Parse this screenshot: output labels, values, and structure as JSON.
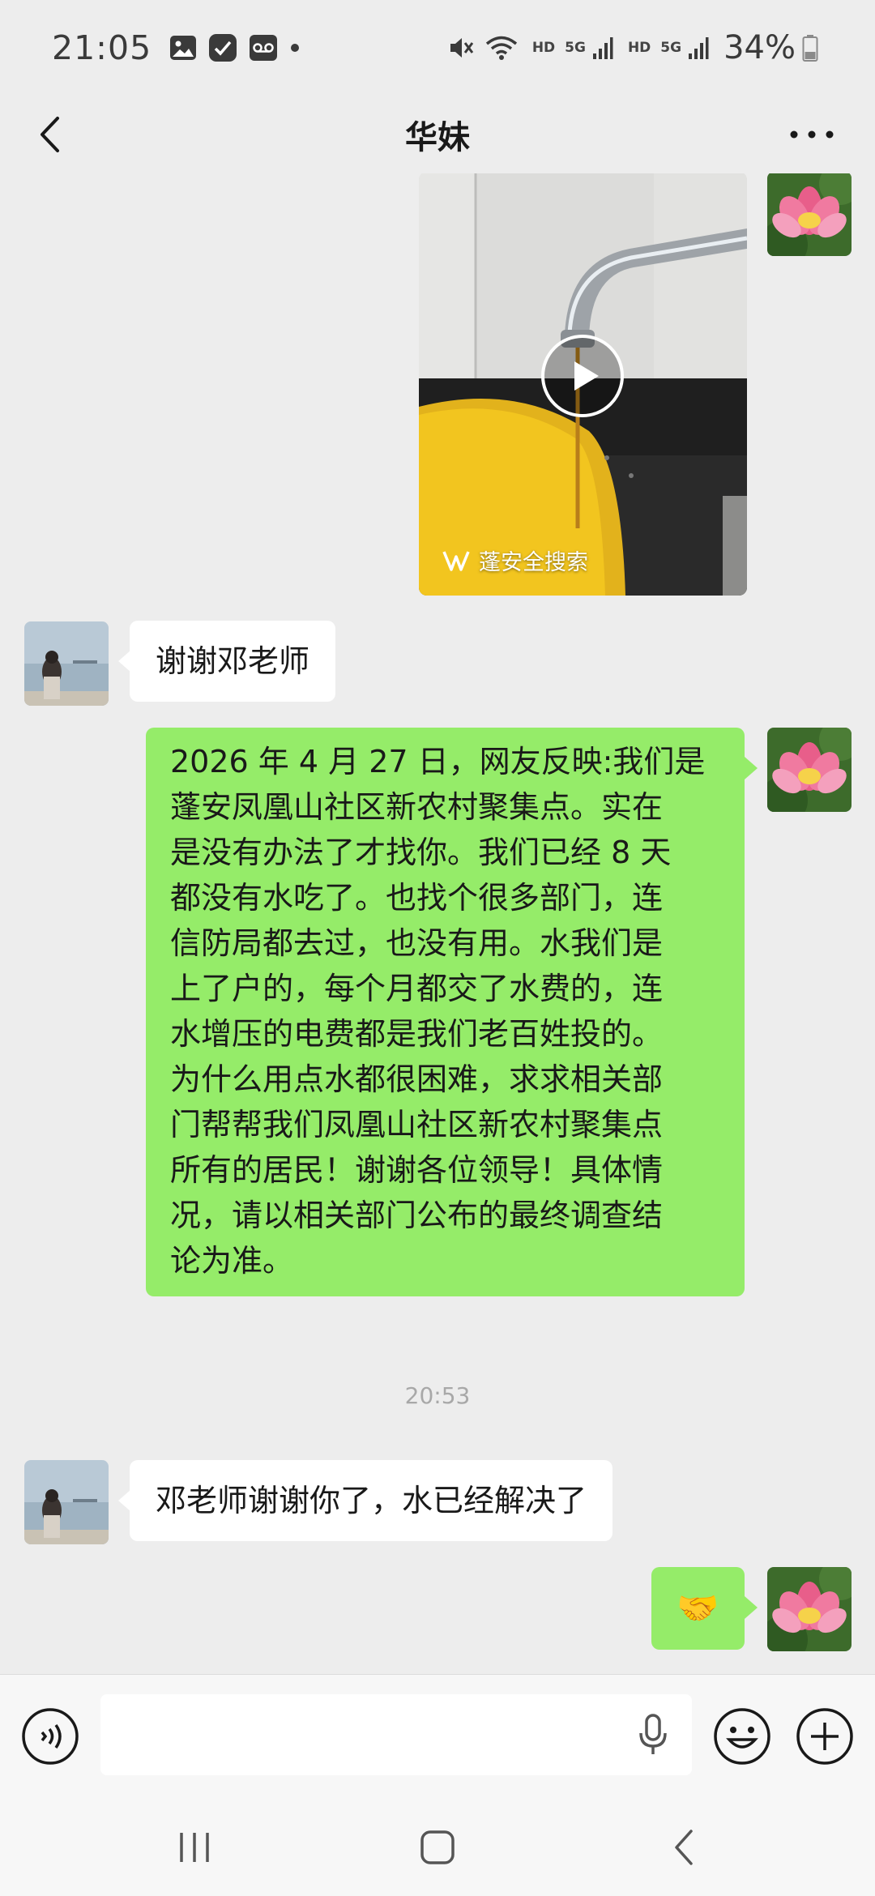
{
  "status_bar": {
    "time": "21:05",
    "network_tag_1": "HD",
    "network_tag_2": "5G",
    "network_tag_3": "HD",
    "network_tag_4": "5G",
    "battery": "34%",
    "icons": [
      "gallery-icon",
      "check-app-icon",
      "voicemail-icon",
      "dot-icon",
      "mute-icon",
      "wifi-icon",
      "signal-icon",
      "signal-icon",
      "battery-icon"
    ]
  },
  "header": {
    "title": "华妹",
    "back_icon": "chevron-left-icon",
    "more_icon": "more-dots-icon"
  },
  "messages": [
    {
      "type": "video",
      "sender": "self",
      "source_label": "蓬安全搜索"
    },
    {
      "type": "text",
      "sender": "other",
      "text": "谢谢邓老师"
    },
    {
      "type": "text",
      "sender": "self",
      "lines": [
        "2026 年 4 月 27 日，网友反映:我们是",
        "蓬安凤凰山社区新农村聚集点。实在",
        "是没有办法了才找你。我们已经 8 天",
        "都没有水吃了。也找个很多部门，连",
        "信防局都去过，也没有用。水我们是",
        "上了户的，每个月都交了水费的，连",
        "水增压的电费都是我们老百姓投的。",
        "为什么用点水都很困难，求求相关部",
        "门帮帮我们凤凰山社区新农村聚集点",
        "所有的居民！谢谢各位领导！具体情",
        "况，请以相关部门公布的最终调查结",
        "论为准。"
      ]
    },
    {
      "type": "time",
      "text": "20:53"
    },
    {
      "type": "text",
      "sender": "other",
      "text": "邓老师谢谢你了，水已经解决了"
    },
    {
      "type": "emoji",
      "sender": "self",
      "text": "🤝"
    }
  ],
  "input_bar": {
    "voice_icon": "voice-input-icon",
    "mic_icon": "microphone-icon",
    "emoji_icon": "emoji-icon",
    "plus_icon": "plus-icon",
    "value": ""
  },
  "system_nav": [
    "recent-apps-icon",
    "home-icon",
    "back-icon"
  ],
  "colors": {
    "background": "#ededed",
    "self_bubble": "#95ec69",
    "other_bubble": "#ffffff",
    "timestamp": "#a8a8a8"
  }
}
